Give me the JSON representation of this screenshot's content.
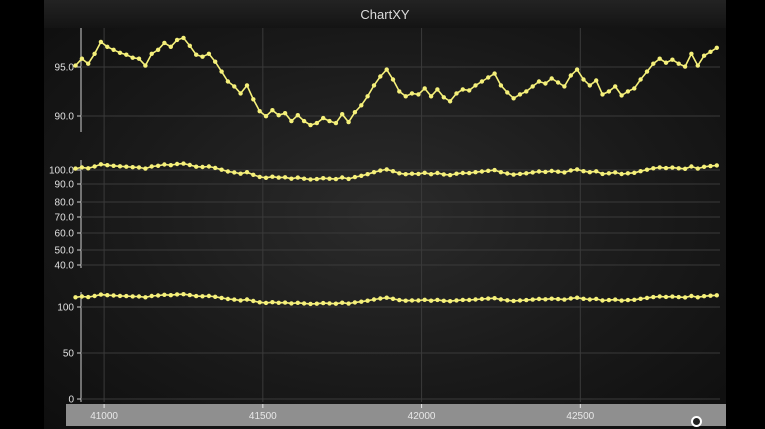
{
  "window": {
    "title": "ChartXY"
  },
  "colors": {
    "series": "#f5f07a",
    "grid": "#3a3a3a",
    "axis": "#cfcfcf",
    "xaxis_bg": "#8f8f8f"
  },
  "chart_data": [
    {
      "type": "line",
      "title": "",
      "ylim": [
        88.5,
        99
      ],
      "yticks": [
        "95.0",
        "90.0"
      ],
      "series": [
        {
          "x": [
            40910,
            40930,
            40950,
            40970,
            40990,
            41010,
            41030,
            41050,
            41070,
            41090,
            41110,
            41130,
            41150,
            41170,
            41190,
            41210,
            41230,
            41250,
            41270,
            41290,
            41310,
            41330,
            41350,
            41370,
            41390,
            41410,
            41430,
            41450,
            41470,
            41490,
            41510,
            41530,
            41550,
            41570,
            41590,
            41610,
            41630,
            41650,
            41670,
            41690,
            41710,
            41730,
            41750,
            41770,
            41790,
            41810,
            41830,
            41850,
            41870,
            41890,
            41910,
            41930,
            41950,
            41970,
            41990,
            42010,
            42030,
            42050,
            42070,
            42090,
            42110,
            42130,
            42150,
            42170,
            42190,
            42210,
            42230,
            42250,
            42270,
            42290,
            42310,
            42330,
            42350,
            42370,
            42390,
            42410,
            42430,
            42450,
            42470,
            42490,
            42510,
            42530,
            42550,
            42570,
            42590,
            42610,
            42630,
            42650,
            42670,
            42690,
            42710,
            42730,
            42750,
            42770,
            42790,
            42810,
            42830,
            42850,
            42870,
            42890,
            42910,
            42930
          ],
          "y": [
            95.2,
            95.9,
            95.4,
            96.4,
            97.6,
            97.1,
            96.8,
            96.5,
            96.3,
            96.0,
            95.9,
            95.2,
            96.4,
            96.8,
            97.5,
            97.1,
            97.8,
            98.0,
            97.2,
            96.3,
            96.1,
            96.4,
            95.6,
            94.6,
            93.6,
            93.1,
            92.4,
            93.2,
            91.8,
            90.6,
            90.1,
            90.7,
            90.2,
            90.4,
            89.6,
            90.2,
            89.6,
            89.2,
            89.4,
            89.9,
            89.6,
            89.4,
            90.3,
            89.5,
            90.5,
            91.2,
            92.1,
            93.2,
            94.1,
            94.8,
            93.8,
            92.6,
            92.1,
            92.4,
            92.3,
            92.9,
            92.1,
            92.8,
            92.0,
            91.6,
            92.4,
            92.8,
            92.7,
            93.2,
            93.6,
            94.0,
            94.4,
            93.2,
            92.5,
            91.9,
            92.3,
            92.6,
            93.1,
            93.6,
            93.4,
            93.9,
            93.5,
            93.1,
            94.2,
            94.8,
            93.8,
            93.2,
            93.7,
            92.3,
            92.6,
            93.1,
            92.2,
            92.6,
            92.9,
            93.8,
            94.6,
            95.4,
            95.9,
            95.5,
            95.8,
            95.4,
            95.1,
            96.4,
            95.2,
            96.2,
            96.6,
            97.0
          ]
        }
      ]
    },
    {
      "type": "line",
      "title": "",
      "ylim": [
        40,
        100
      ],
      "yticks": [
        "100.0",
        "90.0",
        "80.0",
        "70.0",
        "60.0",
        "50.0",
        "40.0"
      ],
      "series": [
        {
          "x": "same as first chart",
          "y": "same as first chart"
        }
      ]
    },
    {
      "type": "line",
      "title": "",
      "ylim": [
        0,
        100
      ],
      "yticks": [
        "100",
        "50",
        "0"
      ],
      "series": [
        {
          "x": "same as first chart",
          "y": "same as first chart"
        }
      ]
    }
  ],
  "x_axis": {
    "range": [
      40880,
      42940
    ],
    "ticks": [
      "41000",
      "41500",
      "42000",
      "42500"
    ],
    "tick_values": [
      41000,
      41500,
      42000,
      42500
    ]
  }
}
